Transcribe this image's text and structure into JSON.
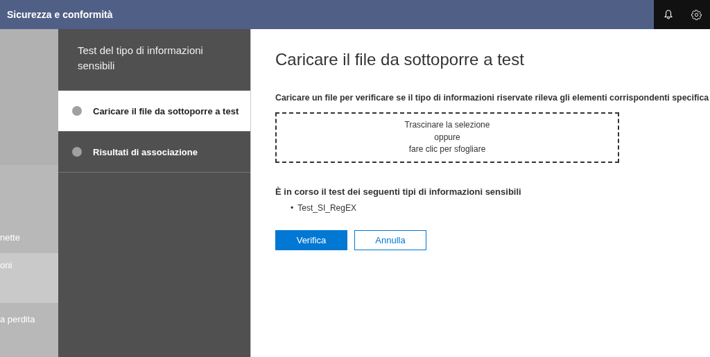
{
  "header": {
    "title": "Sicurezza e conformità"
  },
  "background_nav": {
    "items": [
      {
        "label": "nette",
        "selected": false
      },
      {
        "label": "oni",
        "selected": true
      },
      {
        "label": "a perdita",
        "selected": false
      }
    ]
  },
  "wizard": {
    "title": "Test del tipo di informazioni sensibili",
    "steps": [
      {
        "label": "Caricare il file da sottoporre a test",
        "selected": true
      },
      {
        "label": "Risultati di associazione",
        "selected": false
      }
    ]
  },
  "main": {
    "title": "Caricare il file da sottoporre a test",
    "description": "Caricare un file per verificare se il tipo di informazioni riservate rileva gli elementi corrispondenti specifica",
    "drop_zone": [
      "Trascinare la selezione",
      "oppure",
      "fare clic per sfogliare"
    ],
    "testing_heading": "È in corso il test dei seguenti tipi di informazioni sensibili",
    "testing_items": [
      {
        "marker": "•",
        "text": "Test_SI_RegEX"
      }
    ],
    "buttons": [
      {
        "label": "Verifica",
        "kind": "primary"
      },
      {
        "label": "Annulla",
        "kind": "secondary"
      }
    ]
  }
}
